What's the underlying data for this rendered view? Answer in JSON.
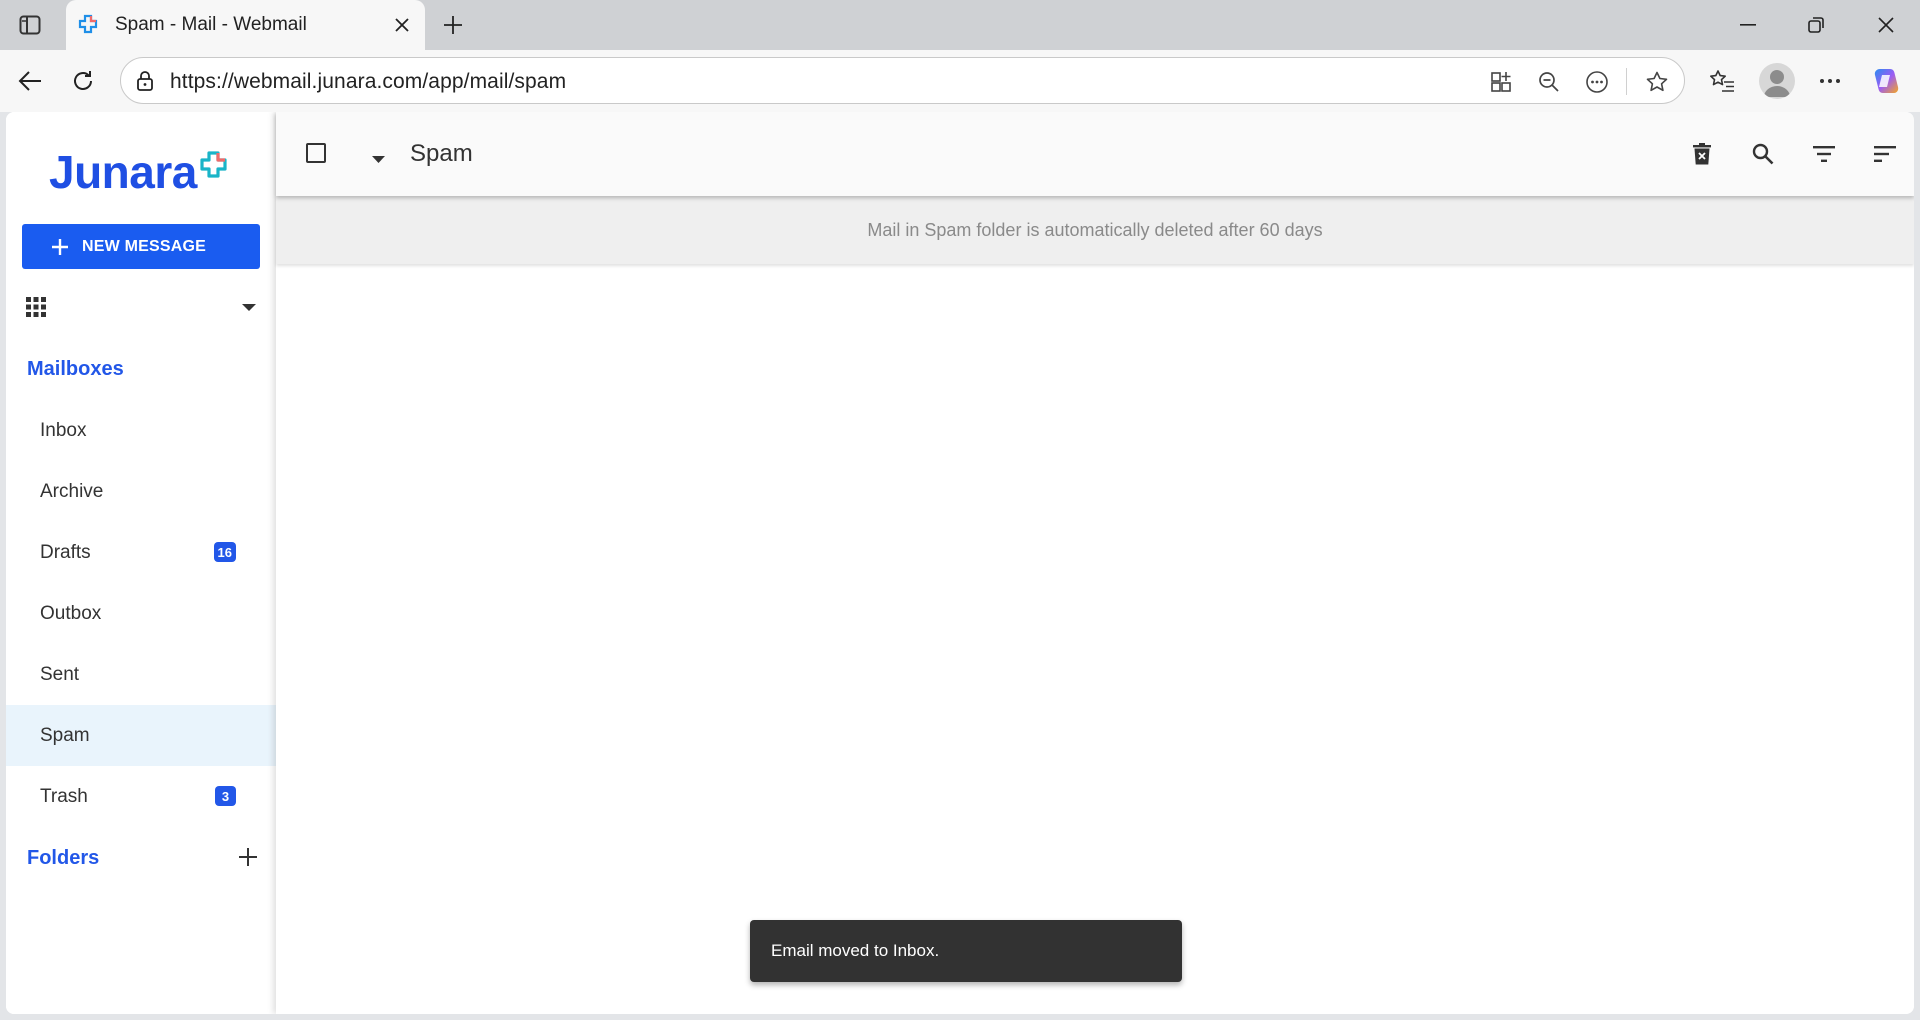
{
  "browser": {
    "tab_title": "Spam - Mail - Webmail",
    "url": "https://webmail.junara.com/app/mail/spam"
  },
  "app": {
    "logo_text": "Junara",
    "new_message_label": "NEW MESSAGE",
    "accent_color": "#1a5cf0"
  },
  "sidebar": {
    "mailboxes_title": "Mailboxes",
    "items": [
      {
        "label": "Inbox",
        "badge": ""
      },
      {
        "label": "Archive",
        "badge": ""
      },
      {
        "label": "Drafts",
        "badge": "16"
      },
      {
        "label": "Outbox",
        "badge": ""
      },
      {
        "label": "Sent",
        "badge": ""
      },
      {
        "label": "Spam",
        "badge": "",
        "active": true
      },
      {
        "label": "Trash",
        "badge": "3"
      }
    ],
    "folders_title": "Folders"
  },
  "main": {
    "folder_title": "Spam",
    "info_text": "Mail in Spam folder is automatically deleted after 60 days",
    "header_icons": [
      "delete-forever-icon",
      "search-icon",
      "filter-icon",
      "sort-icon"
    ]
  },
  "snackbar": {
    "message": "Email moved to Inbox."
  }
}
